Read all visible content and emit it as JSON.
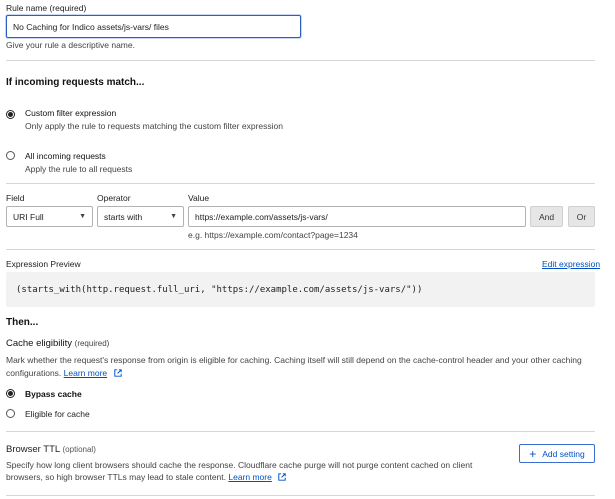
{
  "rule_name": {
    "label": "Rule name (required)",
    "value": "No Caching for Indico assets/js-vars/ files",
    "help": "Give your rule a descriptive name."
  },
  "incoming": {
    "heading": "If incoming requests match...",
    "options": [
      {
        "title": "Custom filter expression",
        "desc": "Only apply the rule to requests matching the custom filter expression",
        "checked": true
      },
      {
        "title": "All incoming requests",
        "desc": "Apply the rule to all requests",
        "checked": false
      }
    ]
  },
  "filter": {
    "field_label": "Field",
    "operator_label": "Operator",
    "value_label": "Value",
    "field_value": "URI Full",
    "operator_value": "starts with",
    "value_value": "https://example.com/assets/js-vars/",
    "value_hint": "e.g. https://example.com/contact?page=1234",
    "and_label": "And",
    "or_label": "Or"
  },
  "expression": {
    "label": "Expression Preview",
    "edit_link": "Edit expression",
    "code": "(starts_with(http.request.full_uri, \"https://example.com/assets/js-vars/\"))"
  },
  "then": {
    "heading": "Then...",
    "cache_eligibility_title": "Cache eligibility",
    "cache_eligibility_required": "(required)",
    "cache_eligibility_desc": "Mark whether the request's response from origin is eligible for caching. Caching itself will still depend on the cache-control header and your other caching configurations.",
    "learn_more": "Learn more",
    "options": [
      {
        "title": "Bypass cache",
        "checked": true
      },
      {
        "title": "Eligible for cache",
        "checked": false
      }
    ]
  },
  "browser_ttl": {
    "title": "Browser TTL",
    "optional": "(optional)",
    "desc": "Specify how long client browsers should cache the response. Cloudflare cache purge will not purge content cached on client browsers, so high browser TTLs may lead to stale content.",
    "learn_more": "Learn more",
    "add_setting": "Add setting"
  },
  "icons": {
    "external_link": "external-link-icon",
    "chevron": "chevron-down-icon",
    "plus": "plus-icon"
  },
  "colors": {
    "link": "#0051c3",
    "focus_border": "#2c5fbf",
    "code_bg": "#f2f2f2"
  }
}
